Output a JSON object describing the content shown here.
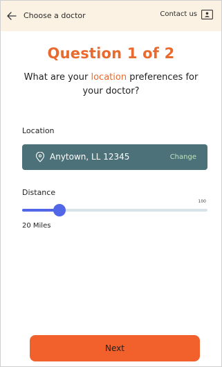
{
  "header": {
    "title": "Choose a doctor",
    "contact_label": "Contact us"
  },
  "question": {
    "title": "Question 1 of 2",
    "text_before": "What are your ",
    "text_highlight": "location",
    "text_after": " preferences for your doctor?"
  },
  "location": {
    "label": "Location",
    "value": "Anytown, LL 12345",
    "change_label": "Change"
  },
  "distance": {
    "label": "Distance",
    "max_label": "100",
    "max": 100,
    "value": 20,
    "value_label": "20 Miles"
  },
  "footer": {
    "next_label": "Next"
  },
  "colors": {
    "accent": "#e96a2e",
    "header_bg": "#fbf2e4",
    "location_bg": "#4d7178",
    "change_text": "#bfe4c2",
    "slider": "#5266e8",
    "slider_track": "#d9e3ea",
    "button": "#f2612c"
  },
  "icons": {
    "back": "arrow-left-icon",
    "contact": "contact-card-icon",
    "location": "map-pin-icon"
  }
}
